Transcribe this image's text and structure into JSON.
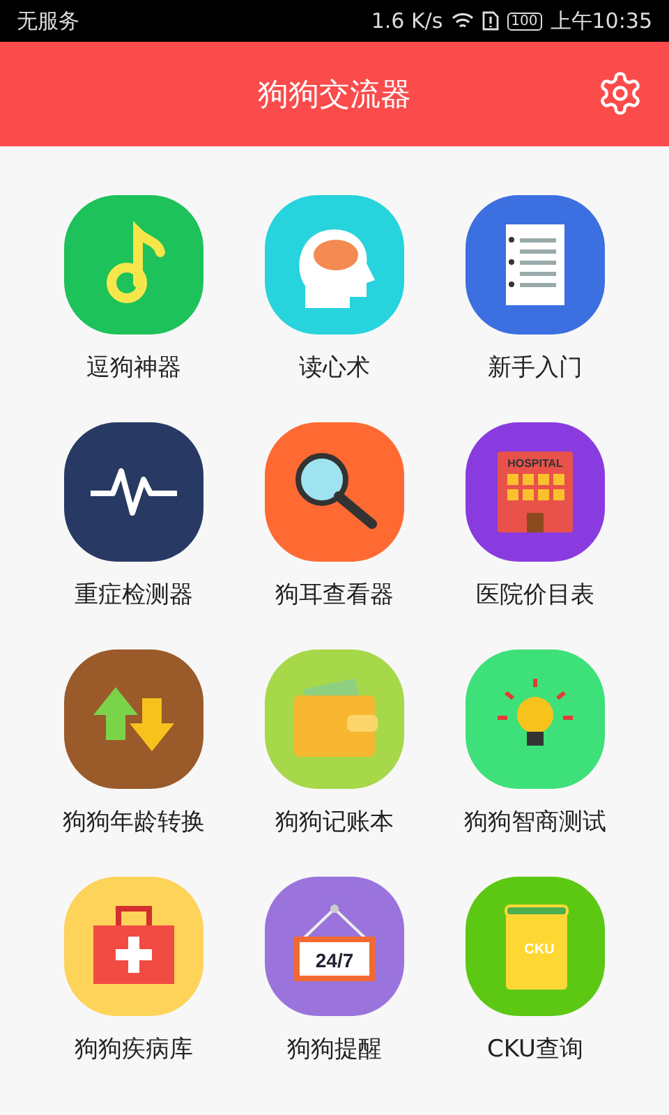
{
  "status_bar": {
    "carrier": "无服务",
    "speed": "1.6 K/s",
    "battery": "100",
    "time": "上午10:35"
  },
  "header": {
    "title": "狗狗交流器"
  },
  "apps": [
    {
      "kind": "music",
      "label": "逗狗神器",
      "color": "#1dc25a"
    },
    {
      "kind": "brain",
      "label": "读心术",
      "color": "#27d3dc"
    },
    {
      "kind": "document",
      "label": "新手入门",
      "color": "#3c6fe0"
    },
    {
      "kind": "pulse",
      "label": "重症检测器",
      "color": "#283a63"
    },
    {
      "kind": "magnifier",
      "label": "狗耳查看器",
      "color": "#ff6a33"
    },
    {
      "kind": "hospital",
      "label": "医院价目表",
      "color": "#8a3be0",
      "icon_text": "HOSPITAL"
    },
    {
      "kind": "arrows",
      "label": "狗狗年龄转换",
      "color": "#9a5a2a"
    },
    {
      "kind": "wallet",
      "label": "狗狗记账本",
      "color": "#a6d84a"
    },
    {
      "kind": "bulb",
      "label": "狗狗智商测试",
      "color": "#3ee07a"
    },
    {
      "kind": "firstaid",
      "label": "狗狗疾病库",
      "color": "#fdd35a"
    },
    {
      "kind": "sign",
      "label": "狗狗提醒",
      "color": "#9a74dc",
      "icon_text": "24/7"
    },
    {
      "kind": "book",
      "label": "CKU查询",
      "color": "#5cc814",
      "icon_text": "CKU"
    }
  ]
}
